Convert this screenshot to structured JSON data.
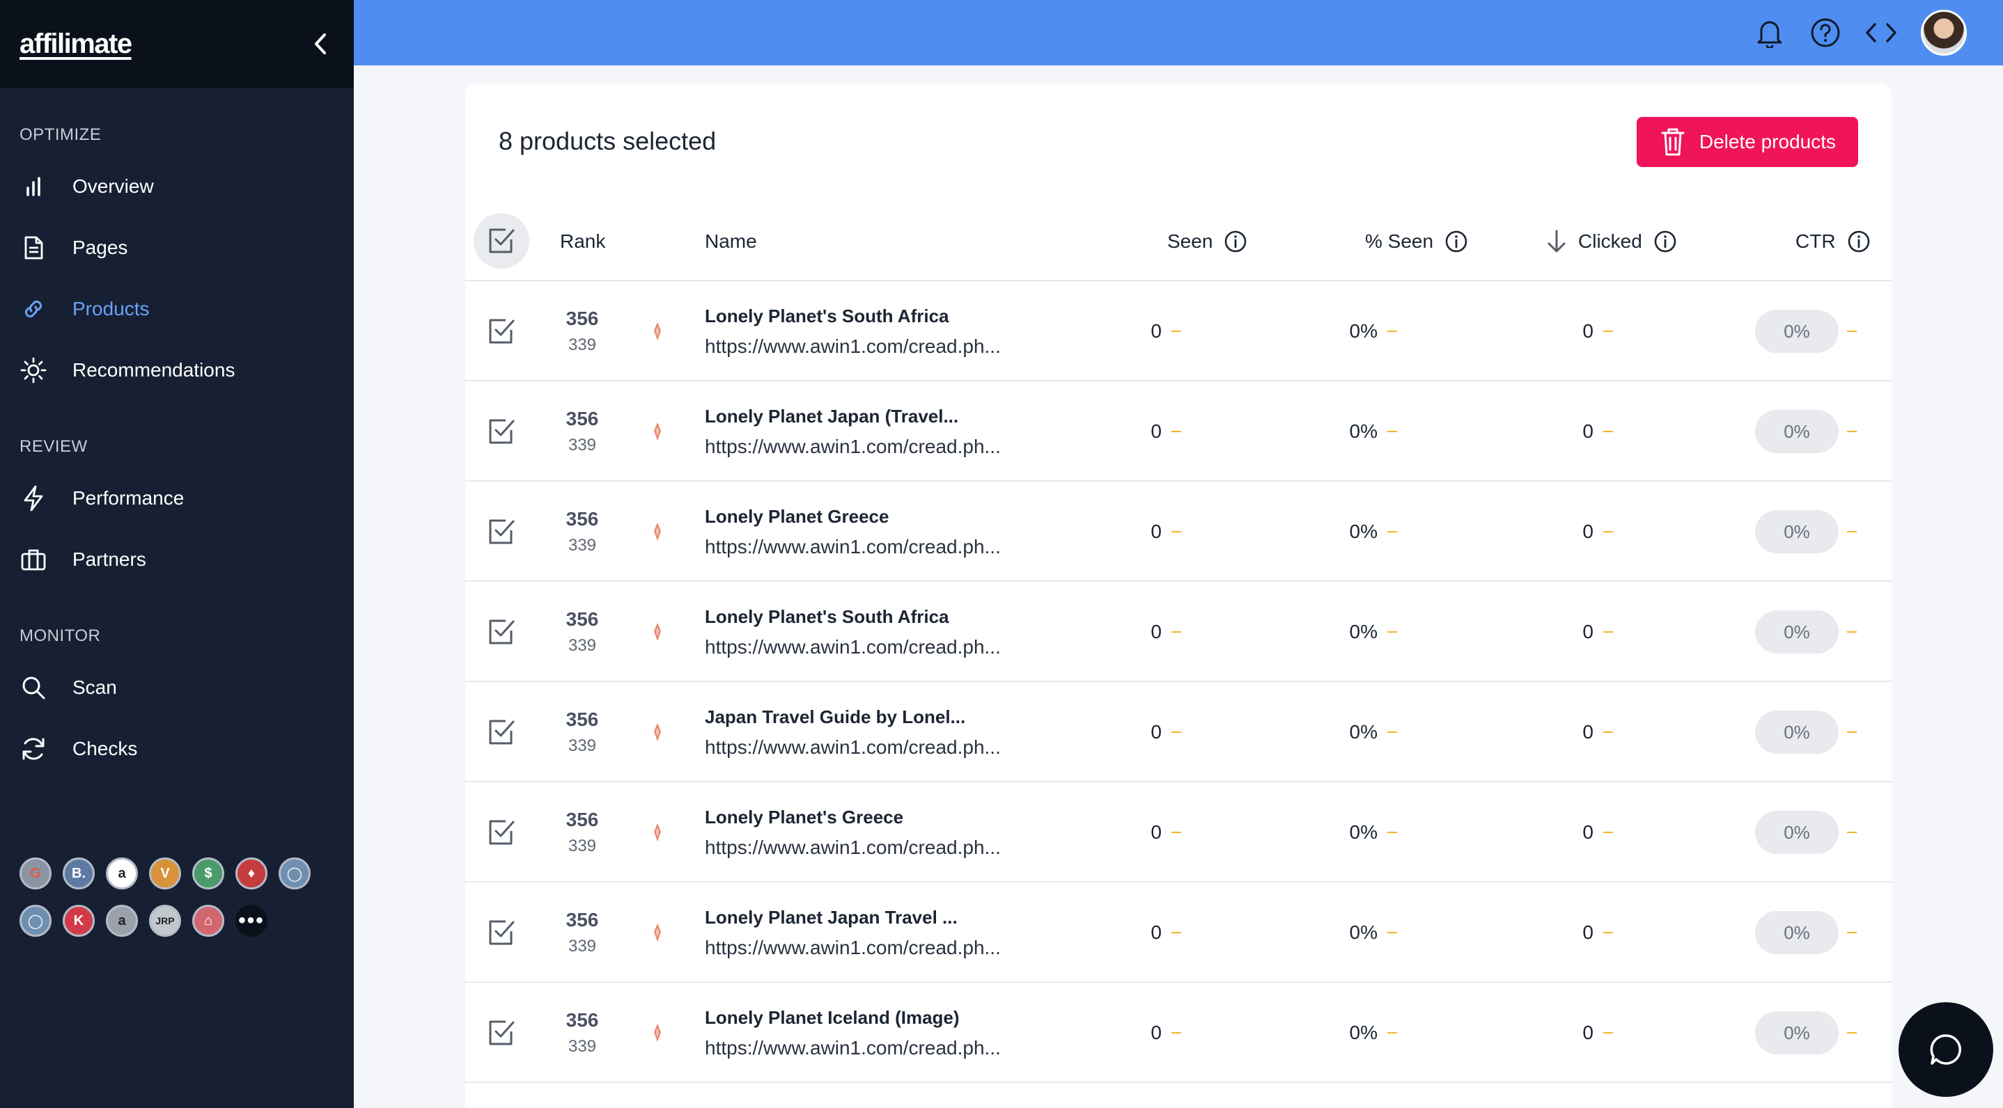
{
  "app": {
    "logo": "affilimate"
  },
  "sidebar": {
    "sections": [
      {
        "title": "OPTIMIZE",
        "items": [
          {
            "label": "Overview",
            "icon": "bar-chart-icon"
          },
          {
            "label": "Pages",
            "icon": "document-icon"
          },
          {
            "label": "Products",
            "icon": "link-icon",
            "active": true
          },
          {
            "label": "Recommendations",
            "icon": "sun-icon"
          }
        ]
      },
      {
        "title": "REVIEW",
        "items": [
          {
            "label": "Performance",
            "icon": "lightning-icon"
          },
          {
            "label": "Partners",
            "icon": "briefcase-icon"
          }
        ]
      },
      {
        "title": "MONITOR",
        "items": [
          {
            "label": "Scan",
            "icon": "search-icon"
          },
          {
            "label": "Checks",
            "icon": "refresh-icon"
          }
        ]
      }
    ],
    "partners": [
      [
        "G",
        "B.",
        "a",
        "V",
        "$",
        "♦",
        "◯"
      ],
      [
        "◯",
        "K",
        "a",
        "JRP",
        "⌂",
        "•••"
      ]
    ]
  },
  "header": {
    "selected_text": "8 products selected",
    "delete_label": "Delete products"
  },
  "table": {
    "columns": {
      "rank": "Rank",
      "name": "Name",
      "seen": "Seen",
      "pct_seen": "% Seen",
      "clicked": "Clicked",
      "ctr": "CTR"
    },
    "rows": [
      {
        "rank": "356",
        "sub": "339",
        "name": "Lonely Planet's South Africa",
        "url": "https://www.awin1.com/cread.ph...",
        "seen": "0",
        "pct_seen": "0%",
        "clicked": "0",
        "ctr": "0%"
      },
      {
        "rank": "356",
        "sub": "339",
        "name": "Lonely Planet Japan (Travel...",
        "url": "https://www.awin1.com/cread.ph...",
        "seen": "0",
        "pct_seen": "0%",
        "clicked": "0",
        "ctr": "0%"
      },
      {
        "rank": "356",
        "sub": "339",
        "name": "Lonely Planet Greece",
        "url": "https://www.awin1.com/cread.ph...",
        "seen": "0",
        "pct_seen": "0%",
        "clicked": "0",
        "ctr": "0%"
      },
      {
        "rank": "356",
        "sub": "339",
        "name": "Lonely Planet's South Africa",
        "url": "https://www.awin1.com/cread.ph...",
        "seen": "0",
        "pct_seen": "0%",
        "clicked": "0",
        "ctr": "0%"
      },
      {
        "rank": "356",
        "sub": "339",
        "name": "Japan Travel Guide by Lonel...",
        "url": "https://www.awin1.com/cread.ph...",
        "seen": "0",
        "pct_seen": "0%",
        "clicked": "0",
        "ctr": "0%"
      },
      {
        "rank": "356",
        "sub": "339",
        "name": "Lonely Planet's Greece",
        "url": "https://www.awin1.com/cread.ph...",
        "seen": "0",
        "pct_seen": "0%",
        "clicked": "0",
        "ctr": "0%"
      },
      {
        "rank": "356",
        "sub": "339",
        "name": "Lonely Planet Japan Travel ...",
        "url": "https://www.awin1.com/cread.ph...",
        "seen": "0",
        "pct_seen": "0%",
        "clicked": "0",
        "ctr": "0%"
      },
      {
        "rank": "356",
        "sub": "339",
        "name": "Lonely Planet Iceland (Image)",
        "url": "https://www.awin1.com/cread.ph...",
        "seen": "0",
        "pct_seen": "0%",
        "clicked": "0",
        "ctr": "0%"
      }
    ]
  },
  "colors": {
    "accent": "#4f8ef0",
    "sidebar": "#162032",
    "danger": "#f0145a",
    "dash": "#f2b62b",
    "active_nav": "#6aa1f5"
  }
}
